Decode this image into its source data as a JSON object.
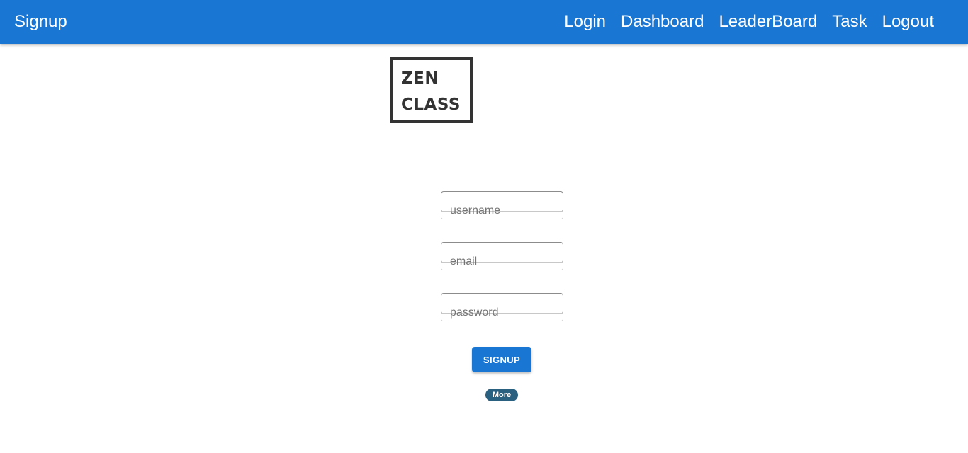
{
  "appbar": {
    "title": "Signup",
    "nav": [
      "Login",
      "Dashboard",
      "LeaderBoard",
      "Task",
      "Logout"
    ],
    "color": "#1976d2"
  },
  "logo": {
    "line1": "ZEN",
    "line2": "CLASS"
  },
  "form": {
    "username_placeholder": "username",
    "email_placeholder": "email",
    "password_placeholder": "password",
    "submit_label": "SIGNUP",
    "more_label": "More"
  }
}
